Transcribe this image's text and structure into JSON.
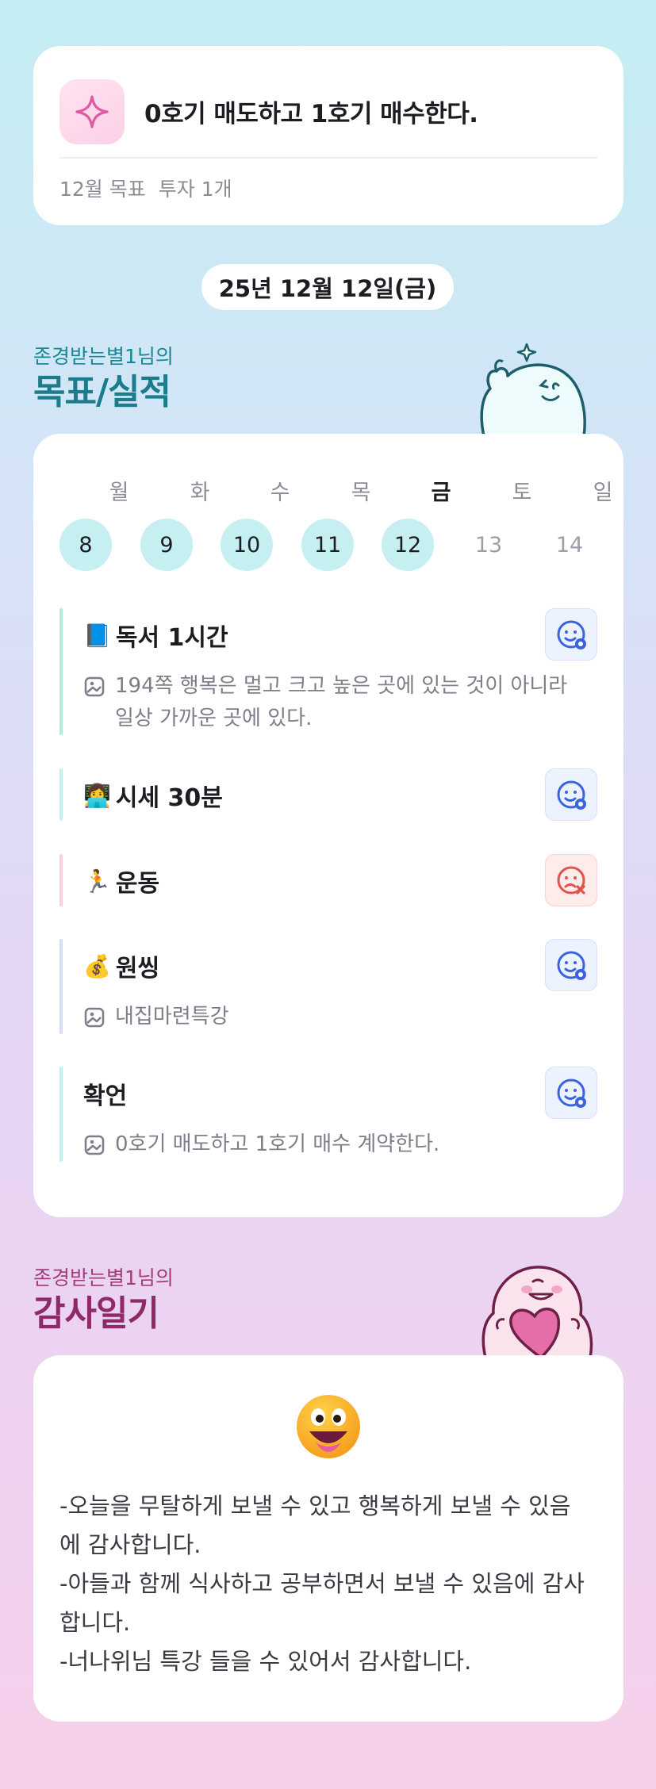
{
  "goal": {
    "title": "0호기 매도하고 1호기 매수한다.",
    "month_label": "12월 목표",
    "category_label": "투자 1개",
    "icon": "sparkle-icon"
  },
  "date_label": "25년 12월 12일(금)",
  "performance": {
    "subtitle": "존경받는별1님의",
    "title": "목표/실적",
    "weekdays": [
      "월",
      "화",
      "수",
      "목",
      "금",
      "토",
      "일"
    ],
    "days": [
      "8",
      "9",
      "10",
      "11",
      "12",
      "13",
      "14"
    ],
    "tasks": [
      {
        "emoji": "📘",
        "name": "독서 1시간",
        "note": "194쪽 행복은 멀고 크고 높은 곳에 있는 것이 아니라 일상 가까운 곳에 있다.",
        "status": "done-smile-icon",
        "bar_color": "#b7ead6"
      },
      {
        "emoji": "👩‍💻",
        "name": "시세 30분",
        "note": "",
        "status": "done-smile-icon",
        "bar_color": "#c6eff2"
      },
      {
        "emoji": "🏃",
        "name": "운동",
        "note": "",
        "status": "failed-sad-icon",
        "bar_color": "#f7cfe0"
      },
      {
        "emoji": "💰",
        "name": "원씽",
        "note": "내집마련특강",
        "status": "done-smile-icon",
        "bar_color": "#d4def5"
      },
      {
        "emoji": "",
        "name": "확언",
        "note": "0호기 매도하고 1호기 매수 계약한다.",
        "status": "done-smile-icon",
        "bar_color": "#c6eff2"
      }
    ]
  },
  "gratitude": {
    "subtitle": "존경받는별1님의",
    "title": "감사일기",
    "emoji_icon": "grinning-face-icon",
    "text": "-오늘을 무탈하게 보낼 수 있고 행복하게 보낼 수 있음에 감사합니다.\n-아들과 함께 식사하고 공부하면서 보낼 수 있음에 감사합니다.\n-너나위님 특강 들을 수 있어서 감사합니다."
  },
  "colors": {
    "accent_teal": "#1d7c8c",
    "accent_pink": "#8e2a68",
    "done_day_bg": "#c6eff2",
    "status_ok": "#3a63e0",
    "status_fail": "#e0524a"
  }
}
